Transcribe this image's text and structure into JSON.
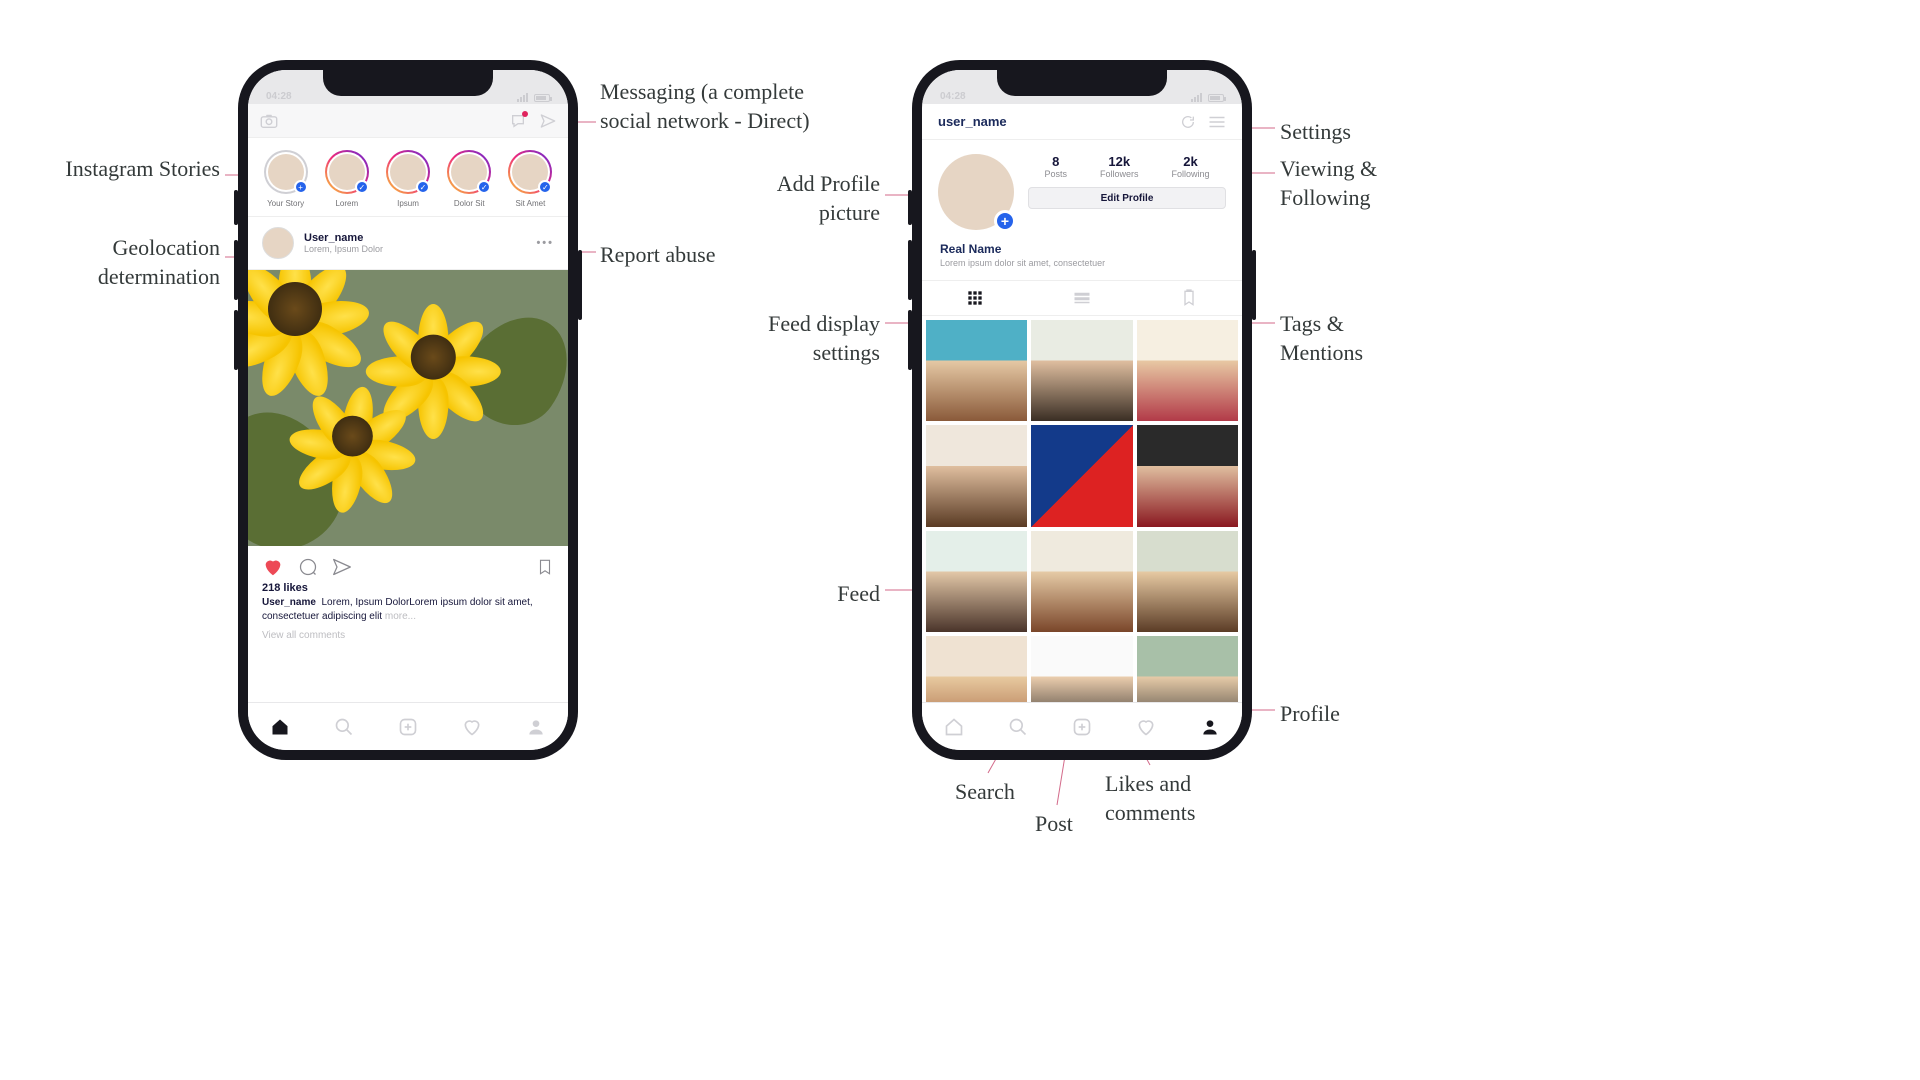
{
  "annotations": {
    "messaging": "Messaging (a complete social network - Direct)",
    "stories": "Instagram Stories",
    "geo": "Geolocation determination",
    "report": "Report abuse",
    "settings": "Settings",
    "viewfollow": "Viewing & Following",
    "addpic": "Add Profile picture",
    "feedset": "Feed display settings",
    "tags": "Tags & Mentions",
    "feed": "Feed",
    "profile": "Profile",
    "search": "Search",
    "post": "Post",
    "likescmts": "Likes and comments"
  },
  "status": {
    "time": "04:28"
  },
  "feed_phone": {
    "stories": [
      {
        "label": "Your Story"
      },
      {
        "label": "Lorem"
      },
      {
        "label": "Ipsum"
      },
      {
        "label": "Dolor Sit"
      },
      {
        "label": "Sit Amet"
      }
    ],
    "post": {
      "username": "User_name",
      "location": "Lorem, Ipsum Dolor",
      "likes": "218 likes",
      "caption_user": "User_name",
      "caption_text": "Lorem, Ipsum DolorLorem ipsum dolor sit amet, consectetuer adipiscing elit",
      "more": "more...",
      "view_comments": "View all comments"
    }
  },
  "profile_phone": {
    "header": {
      "username": "user_name"
    },
    "stats": {
      "posts_n": "8",
      "posts_l": "Posts",
      "followers_n": "12k",
      "followers_l": "Followers",
      "following_n": "2k",
      "following_l": "Following"
    },
    "edit": "Edit Profile",
    "bio": {
      "name": "Real Name",
      "text": "Lorem ipsum dolor sit amet, consectetuer"
    }
  }
}
